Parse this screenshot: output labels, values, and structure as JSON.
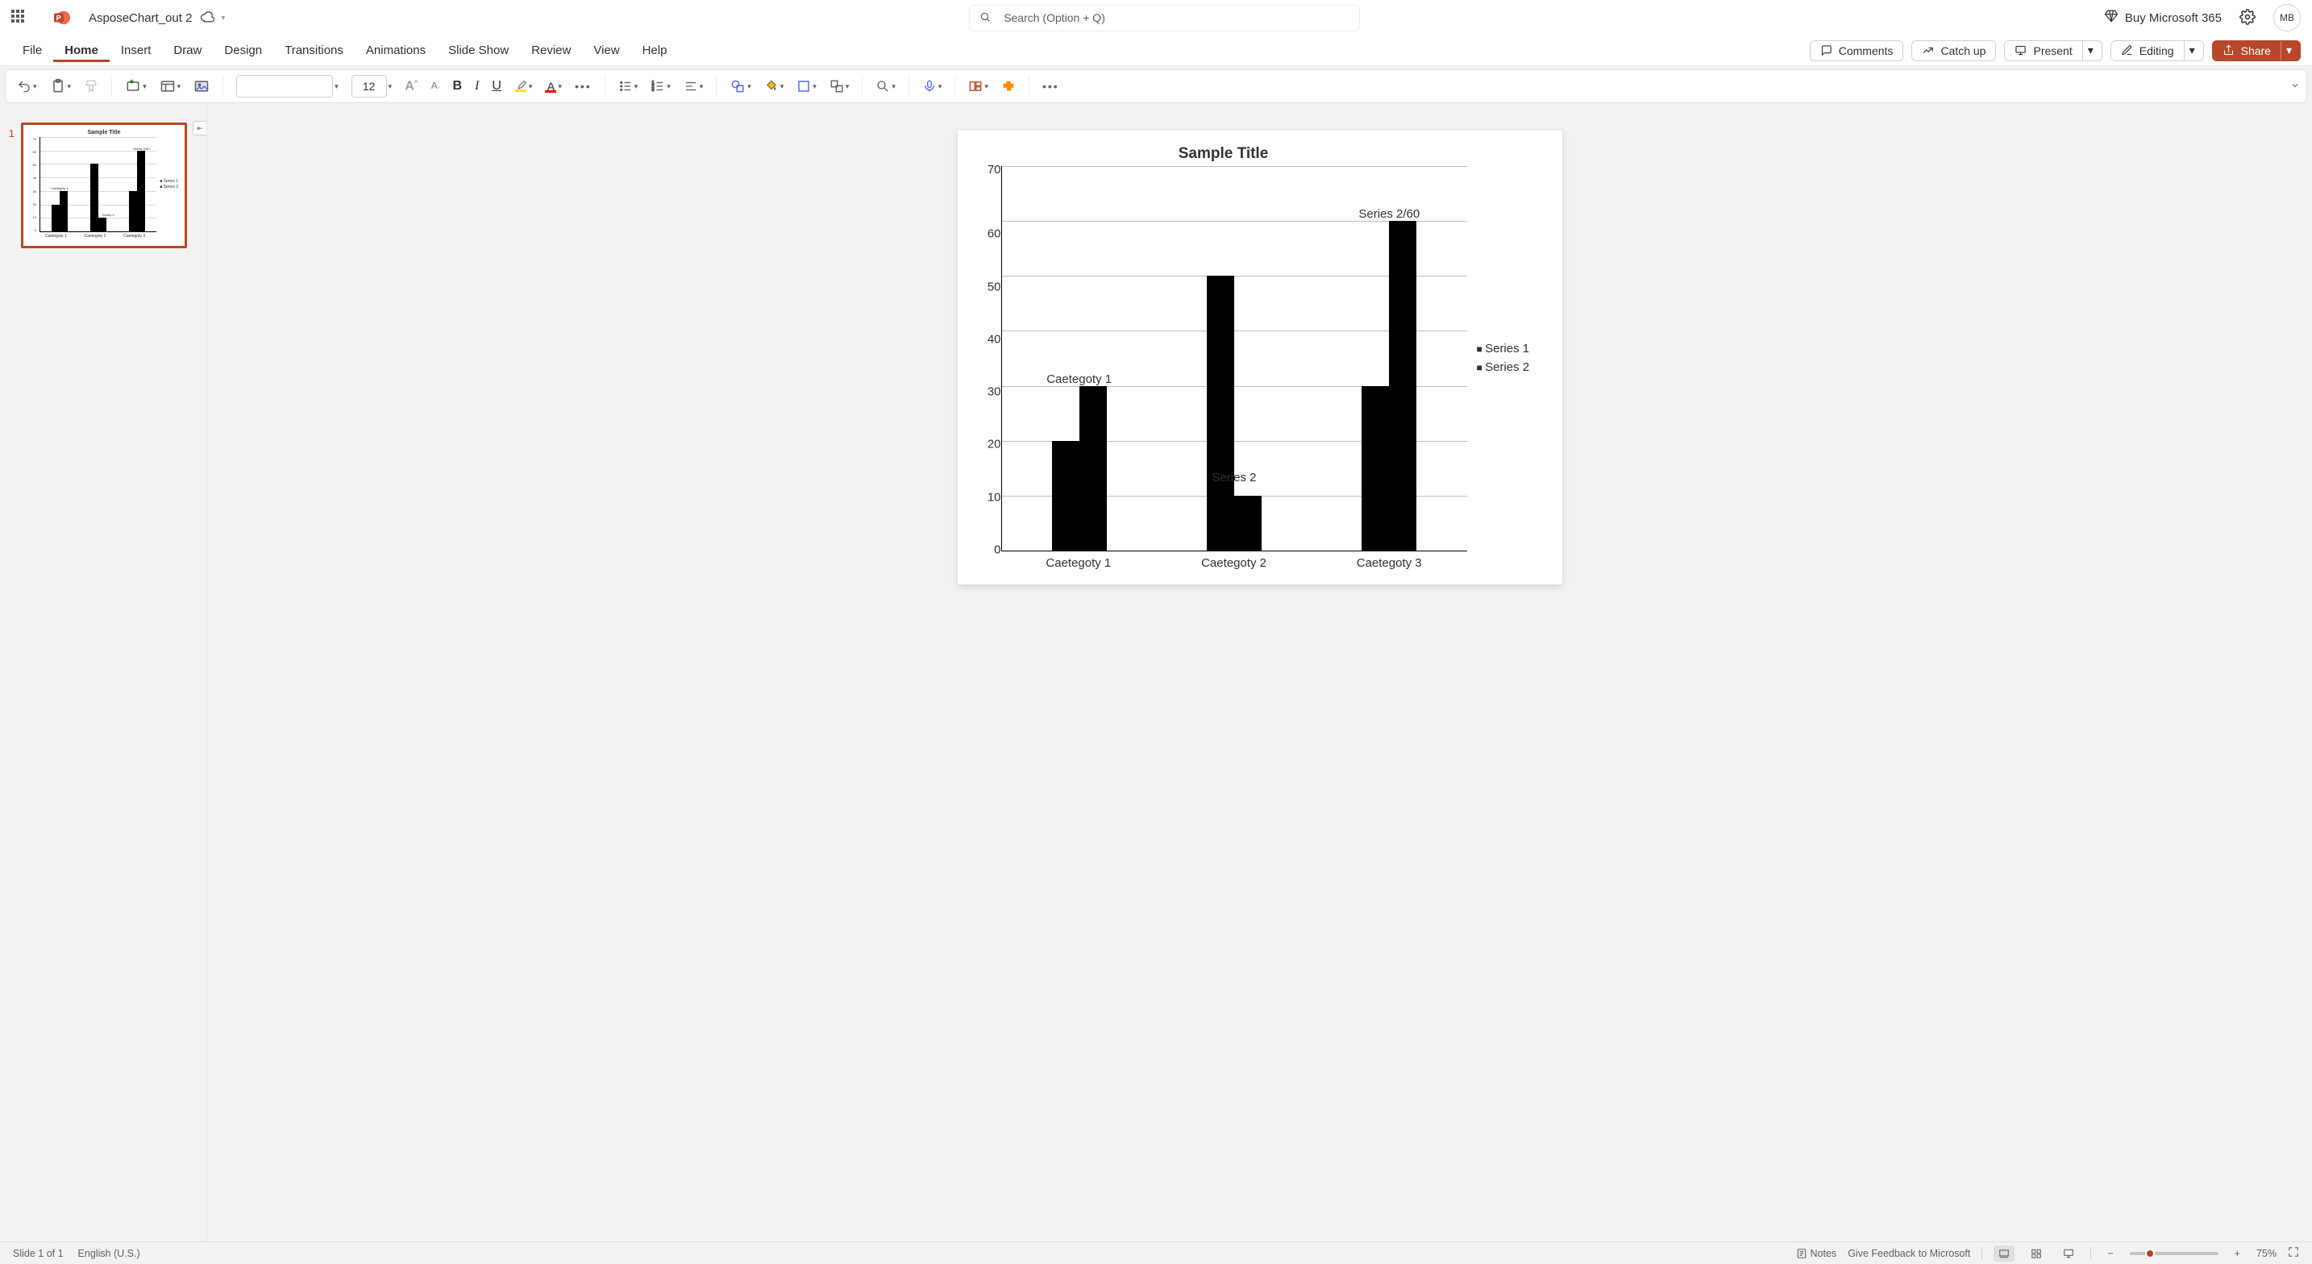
{
  "doc_name": "AsposeChart_out 2",
  "search_placeholder": "Search (Option + Q)",
  "buy_label": "Buy Microsoft 365",
  "avatar_initials": "MB",
  "tabs": {
    "file": "File",
    "home": "Home",
    "insert": "Insert",
    "draw": "Draw",
    "design": "Design",
    "transitions": "Transitions",
    "animations": "Animations",
    "slideshow": "Slide Show",
    "review": "Review",
    "view": "View",
    "help": "Help"
  },
  "actions": {
    "comments": "Comments",
    "catch_up": "Catch up",
    "present": "Present",
    "editing": "Editing",
    "share": "Share"
  },
  "ribbon": {
    "font_size": "12"
  },
  "thumb": {
    "index": "1",
    "title": "Sample Title",
    "legend1": "Series 1",
    "legend2": "Series 2",
    "ann1": "Caetegoty 1",
    "ann2": "Series 2",
    "ann3": "Series 2/60",
    "x1": "Caetegoty 1",
    "x2": "Caetegoty 2",
    "x3": "Caetegoty 3"
  },
  "status": {
    "slide": "Slide 1 of 1",
    "lang": "English (U.S.)",
    "notes": "Notes",
    "feedback": "Give Feedback to Microsoft",
    "zoom": "75%"
  },
  "chart_data": {
    "type": "bar",
    "title": "Sample Title",
    "categories": [
      "Caetegoty 1",
      "Caetegoty 2",
      "Caetegoty 3"
    ],
    "series": [
      {
        "name": "Series 1",
        "values": [
          20,
          50,
          30
        ]
      },
      {
        "name": "Series 2",
        "values": [
          30,
          10,
          60
        ]
      }
    ],
    "ylim": [
      0,
      70
    ],
    "yticks": [
      0,
      10,
      20,
      30,
      40,
      50,
      60,
      70
    ],
    "data_labels": [
      {
        "text": "Caetegoty 1",
        "cat": 0,
        "y": 30
      },
      {
        "text": "Series 2",
        "cat": 1,
        "y": 12
      },
      {
        "text": "Series 2/60",
        "cat": 2,
        "y": 60
      }
    ],
    "xlabel": "",
    "ylabel": ""
  },
  "y_tick_labels": {
    "t0": "0",
    "t1": "10",
    "t2": "20",
    "t3": "30",
    "t4": "40",
    "t5": "50",
    "t6": "60",
    "t7": "70"
  }
}
